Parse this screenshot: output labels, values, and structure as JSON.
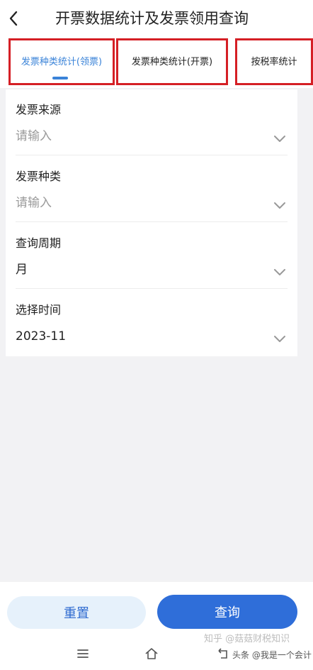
{
  "header": {
    "back_icon": "chevron-left-icon",
    "title": "开票数据统计及发票领用查询"
  },
  "tabs": [
    {
      "label": "发票种类统计(领票)",
      "active": true
    },
    {
      "label": "发票种类统计(开票)",
      "active": false
    },
    {
      "label": "按税率统计",
      "active": false
    }
  ],
  "form": {
    "fields": [
      {
        "label": "发票来源",
        "value": "请输入",
        "is_placeholder": true
      },
      {
        "label": "发票种类",
        "value": "请输入",
        "is_placeholder": true
      },
      {
        "label": "查询周期",
        "value": "月",
        "is_placeholder": false
      },
      {
        "label": "选择时间",
        "value": "2023-11",
        "is_placeholder": false
      }
    ]
  },
  "buttons": {
    "reset": "重置",
    "query": "查询"
  },
  "nav": {
    "icons": [
      "menu-icon",
      "home-icon",
      "back-icon"
    ]
  },
  "watermark": {
    "line1": "知乎 @菇菇财税知识",
    "line2": "头条 @我是一个会计"
  },
  "colors": {
    "accent": "#3a83d8",
    "highlight_box": "#d51f25",
    "query_button": "#2f6ed9",
    "reset_button_bg": "#e6f1fb"
  }
}
